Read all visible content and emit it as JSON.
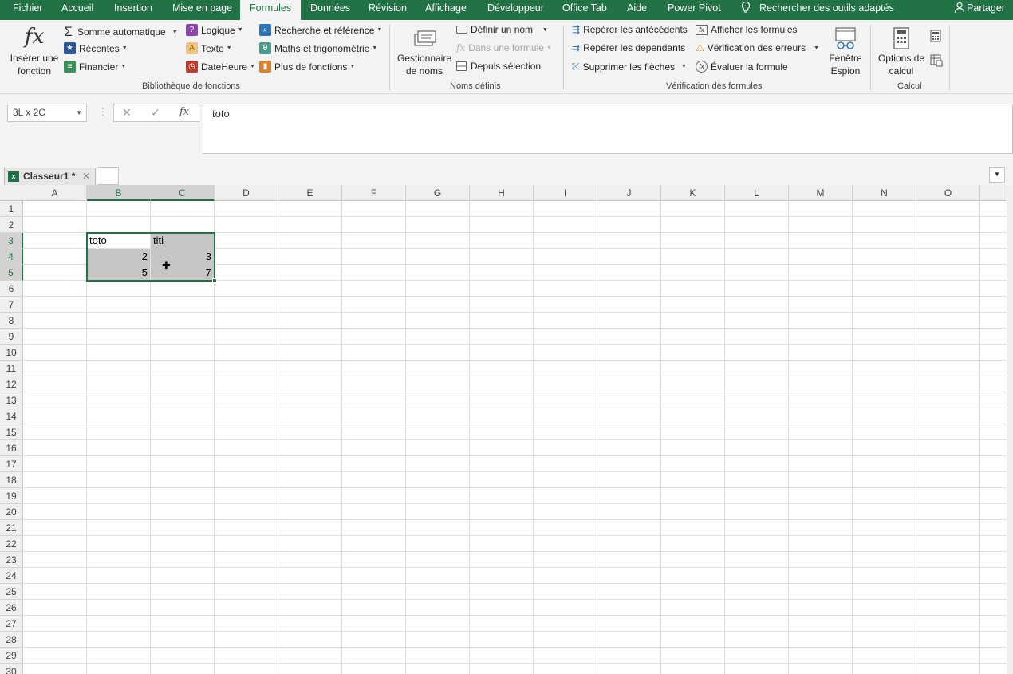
{
  "menu": {
    "tabs": [
      "Fichier",
      "Accueil",
      "Insertion",
      "Mise en page",
      "Formules",
      "Données",
      "Révision",
      "Affichage",
      "Développeur",
      "Office Tab",
      "Aide",
      "Power Pivot"
    ],
    "active_tab": "Formules",
    "search": "Rechercher des outils adaptés",
    "share": "Partager"
  },
  "ribbon": {
    "bibliotheque": {
      "insert_function": "Insérer une fonction",
      "somme": "Somme automatique",
      "recentes": "Récentes",
      "financier": "Financier",
      "logique": "Logique",
      "texte": "Texte",
      "dateheure": "DateHeure",
      "recherche": "Recherche et référence",
      "maths": "Maths et trigonométrie",
      "plus": "Plus de fonctions",
      "label": "Bibliothèque de fonctions"
    },
    "noms": {
      "gestionnaire": "Gestionnaire de noms",
      "definir": "Définir un nom",
      "dans_formule": "Dans une formule",
      "depuis_selection": "Depuis sélection",
      "label": "Noms définis"
    },
    "verification": {
      "antecedents": "Repérer les antécédents",
      "dependants": "Repérer les dépendants",
      "supprimer": "Supprimer les flèches",
      "afficher": "Afficher les formules",
      "erreurs": "Vérification des erreurs",
      "evaluer": "Évaluer la formule",
      "fenetre": "Fenêtre Espion",
      "label": "Vérification des formules"
    },
    "calcul": {
      "options": "Options de calcul",
      "label": "Calcul"
    }
  },
  "formula_bar": {
    "name_box": "3L x 2C",
    "content": "toto",
    "fx": "fx"
  },
  "doc_tab": {
    "label": "Classeur1 *"
  },
  "grid": {
    "columns": [
      "A",
      "B",
      "C",
      "D",
      "E",
      "F",
      "G",
      "H",
      "I",
      "J",
      "K",
      "L",
      "M",
      "N",
      "O"
    ],
    "rows": [
      "1",
      "2",
      "3",
      "4",
      "5",
      "6",
      "7",
      "8",
      "9",
      "10",
      "11",
      "12",
      "13",
      "14",
      "15",
      "16",
      "17",
      "18",
      "19",
      "20",
      "21",
      "22",
      "23",
      "24",
      "25",
      "26",
      "27",
      "28",
      "29",
      "30"
    ],
    "cells": {
      "B3": "toto",
      "C3": "titi",
      "B4": "2",
      "C4": "3",
      "B5": "5",
      "C5": "7"
    }
  },
  "colors": {
    "accent": "#217346",
    "selection_fill": "#c6c6c6"
  }
}
